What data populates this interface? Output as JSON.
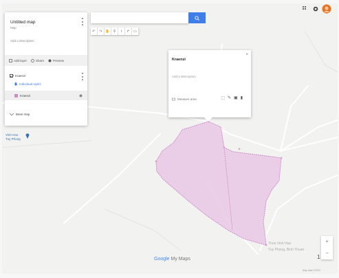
{
  "panel": {
    "title": "Untitled map",
    "subtitle": "Map",
    "description": "Add a description",
    "actions": [
      {
        "icon": "add-layer-icon",
        "label": "Add layer"
      },
      {
        "icon": "share-icon",
        "label": "Share"
      },
      {
        "icon": "preview-icon",
        "label": "Preview"
      }
    ],
    "layer_name": "Kraenzi",
    "layer_style": "Individual styles",
    "feature_name": "Kraenzi",
    "base_map": "Base map"
  },
  "search": {
    "placeholder": ""
  },
  "popup": {
    "title": "Kraenzi",
    "description": "Add a description",
    "foot": "Measure area"
  },
  "map": {
    "pin_label_1": "Vinh Hao",
    "pin_label_2": "Tuy Phong",
    "place_line_1": "Thon Vinh Hao",
    "place_line_2": "Tuy Phong, Binh Thuan",
    "watermark_a": "Google",
    "watermark_b": "My Maps",
    "attribution": "Map data ©2023",
    "scale_value": "1"
  },
  "colors": {
    "polygon_fill": "#e9c8e6",
    "polygon_stroke": "#c98ec4",
    "accent": "#3f7ee8"
  }
}
